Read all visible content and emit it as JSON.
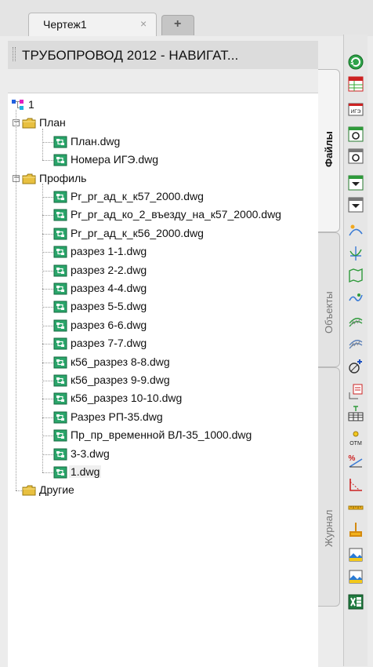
{
  "tabs": {
    "doc_tab_label": "Чертеж1",
    "close_glyph": "×",
    "new_tab_glyph": "+"
  },
  "title": "ТРУБОПРОВОД 2012 - НАВИГАТ...",
  "side_tabs": [
    "Файлы",
    "Объекты",
    "Журнал"
  ],
  "tree": {
    "root": "1",
    "groups": [
      {
        "label": "План",
        "expanded": true,
        "files": [
          "План.dwg",
          "Номера ИГЭ.dwg"
        ]
      },
      {
        "label": "Профиль",
        "expanded": true,
        "files": [
          "Pr_pr_ад_к_к57_2000.dwg",
          "Pr_pr_ад_ко_2_въезду_на_к57_2000.dwg",
          "Pr_pr_ад_к_к56_2000.dwg",
          "разрез 1-1.dwg",
          "разрез 2-2.dwg",
          "разрез 4-4.dwg",
          "разрез 5-5.dwg",
          "разрез 6-6.dwg",
          "разрез 7-7.dwg",
          "к56_разрез 8-8.dwg",
          "к56_разрез 9-9.dwg",
          "к56_разрез 10-10.dwg",
          "Разрез РП-35.dwg",
          "Пр_пр_временной ВЛ-35_1000.dwg",
          "3-3.dwg",
          "1.dwg"
        ]
      },
      {
        "label": "Другие",
        "expanded": false,
        "files": []
      }
    ],
    "selected_file": "1.dwg"
  },
  "toolbar_icons": [
    "refresh-icon",
    "table-icon",
    "ige-icon",
    "tool-green-1-icon",
    "tool-gray-1-icon",
    "tool-green-2-icon",
    "tool-gray-2-icon",
    "curve-icon",
    "axis-icon",
    "map-icon",
    "squiggle-icon",
    "hatch-1-icon",
    "hatch-2-icon",
    "add-circle-icon",
    "stack-icon",
    "table-scale-icon",
    "elevation-icon",
    "percent-slope-icon",
    "dimension-icon",
    "ruler-icon",
    "bracket-icon",
    "photo-1-icon",
    "photo-2-icon",
    "excel-icon"
  ],
  "toolbar_badges": {
    "ige": "ИГЭ",
    "elevation": "ОТМ",
    "percent": "%"
  }
}
